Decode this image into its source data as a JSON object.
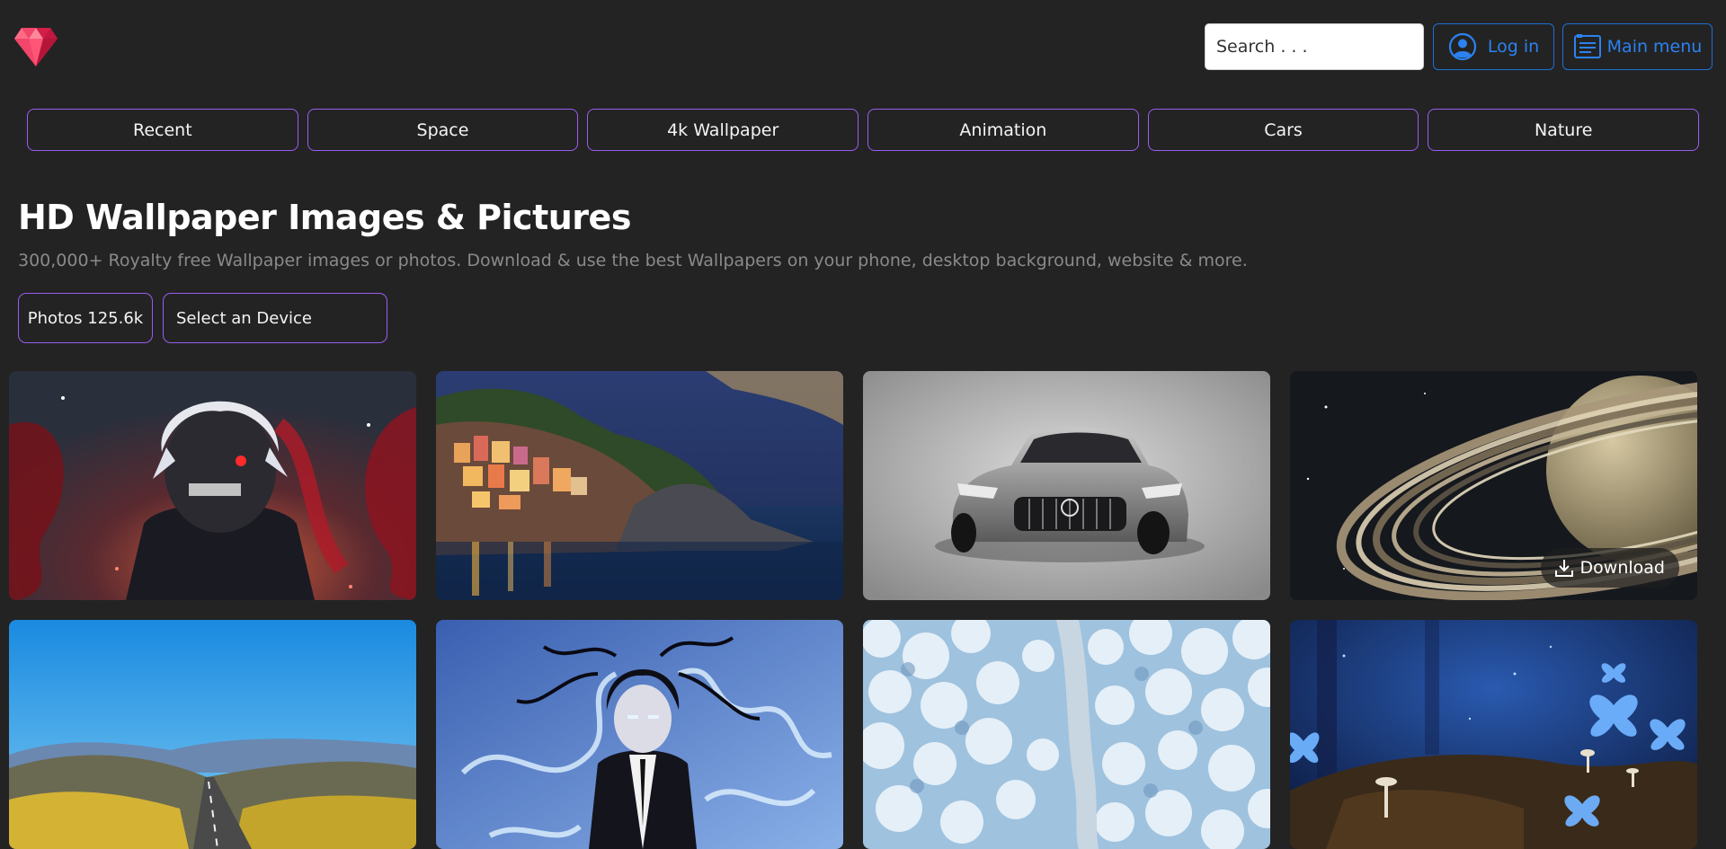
{
  "header": {
    "logo_icon": "ruby-gem-icon",
    "search_placeholder": "Search . . .",
    "login_label": "Log in",
    "login_icon": "user-circle-icon",
    "menu_label": "Main menu",
    "menu_icon": "menu-list-icon"
  },
  "categories": [
    "Recent",
    "Space",
    "4k Wallpaper",
    "Animation",
    "Cars",
    "Nature"
  ],
  "intro": {
    "title": "HD Wallpaper Images & Pictures",
    "subtitle": "300,000+ Royalty free Wallpaper images or photos. Download & use the best Wallpapers on your phone, desktop background, website & more."
  },
  "filters": {
    "photos_label": "Photos 125.6k",
    "device_placeholder": "Select an Device"
  },
  "gallery": {
    "download_label": "Download",
    "download_icon": "download-icon",
    "items": [
      {
        "subject": "anime-ghoul"
      },
      {
        "subject": "coastal-village-night"
      },
      {
        "subject": "silver-sports-car"
      },
      {
        "subject": "ringed-planet"
      },
      {
        "subject": "mountain-road"
      },
      {
        "subject": "anime-suit-character"
      },
      {
        "subject": "snowy-forest-road"
      },
      {
        "subject": "blue-butterflies"
      }
    ]
  },
  "colors": {
    "background": "#232323",
    "accent_purple": "#9b5cf0",
    "accent_blue": "#2b82f0"
  }
}
